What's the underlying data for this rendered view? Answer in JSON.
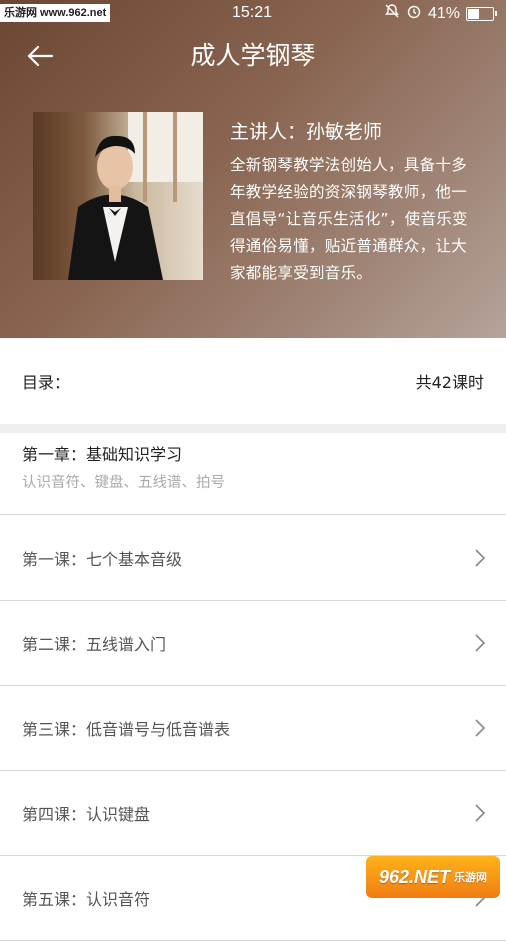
{
  "watermark": {
    "top_left": "乐游网 www.962.net",
    "bottom_right_main": "962.NET",
    "bottom_right_sub": "乐游网"
  },
  "status_bar": {
    "time": "15:21",
    "battery": "41%",
    "battery_level": 0.41
  },
  "header": {
    "title": "成人学钢琴"
  },
  "course": {
    "presenter": "主讲人：孙敏老师",
    "description": "全新钢琴教学法创始人，具备十多年教学经验的资深钢琴教师，他一直倡导“让音乐生活化”，使音乐变得通俗易懂，贴近普通群众，让大家都能享受到音乐。"
  },
  "toc": {
    "label": "目录：",
    "count": "共42课时"
  },
  "chapter": {
    "title": "第一章：基础知识学习",
    "subtitle": "认识音符、键盘、五线谱、拍号"
  },
  "lessons": [
    {
      "label": "第一课：七个基本音级"
    },
    {
      "label": "第二课：五线谱入门"
    },
    {
      "label": "第三课：低音谱号与低音谱表"
    },
    {
      "label": "第四课：认识键盘"
    },
    {
      "label": "第五课：认识音符"
    }
  ],
  "colors": {
    "hero_start": "#6b4632",
    "hero_end": "#b6a39b",
    "divider": "#d6d6d6",
    "muted_text": "#aaaaaa"
  }
}
